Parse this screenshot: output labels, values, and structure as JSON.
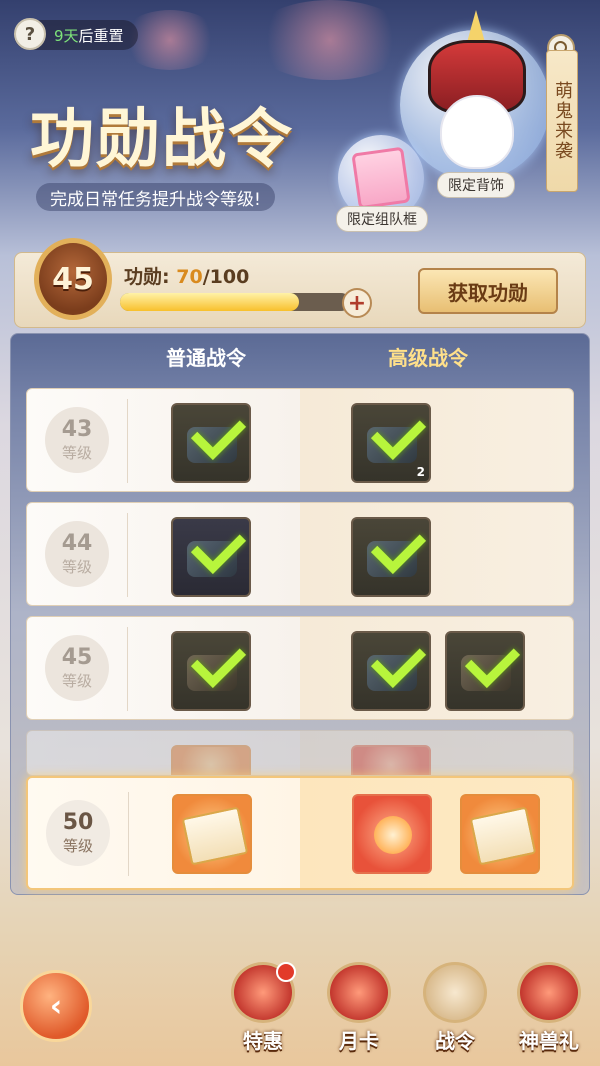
{
  "header": {
    "help_symbol": "?",
    "reset_days": "9天",
    "reset_suffix": "后重置",
    "title": "功勋战令",
    "subtitle": "完成日常任务提升战令等级!",
    "side_banner": "萌鬼来袭",
    "bubble_backpiece_label": "限定背饰",
    "bubble_frame_label": "限定组队框"
  },
  "progress": {
    "level": "45",
    "merit_label": "功勋:",
    "merit_current": "70",
    "merit_total": "/100",
    "fill_fraction": 0.78,
    "plus_symbol": "+",
    "get_button": "获取功勋"
  },
  "columns": {
    "free": "普通战令",
    "premium": "高级战令"
  },
  "rows": [
    {
      "level": "43",
      "level_word": "等级",
      "free_claimed": true,
      "premium": [
        {
          "claimed": true,
          "count": "2"
        }
      ]
    },
    {
      "level": "44",
      "level_word": "等级",
      "free_claimed": true,
      "premium": [
        {
          "claimed": true
        }
      ]
    },
    {
      "level": "45",
      "level_word": "等级",
      "free_claimed": true,
      "premium": [
        {
          "claimed": true
        },
        {
          "claimed": true
        }
      ]
    },
    {
      "level": "50",
      "level_word": "等级",
      "free_claimed": false,
      "premium": [
        {
          "claimed": false
        },
        {
          "claimed": false
        }
      ]
    }
  ],
  "nav": {
    "back_symbol": "‹",
    "items": [
      {
        "label": "特惠",
        "icon": "gift-chest-icon"
      },
      {
        "label": "月卡",
        "icon": "month-card-icon"
      },
      {
        "label": "战令",
        "icon": "battle-pass-icon"
      },
      {
        "label": "神兽礼",
        "icon": "beast-gift-icon"
      }
    ]
  },
  "colors": {
    "accent_gold": "#f8c02c",
    "check_green": "#b8f53c",
    "premium_header": "#ffe08a"
  }
}
